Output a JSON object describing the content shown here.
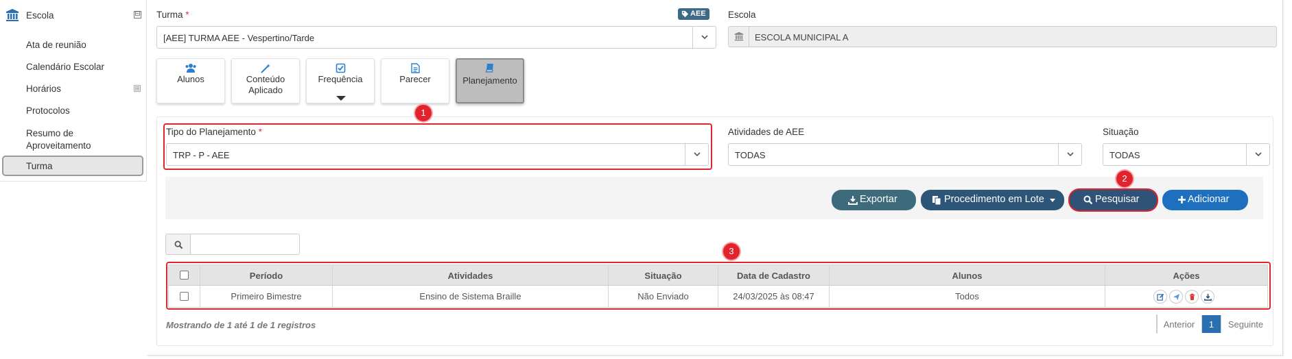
{
  "sidebar": {
    "title": "Escola",
    "items": [
      {
        "label": "Ata de reunião"
      },
      {
        "label": "Calendário Escolar"
      },
      {
        "label": "Horários"
      },
      {
        "label": "Protocolos"
      },
      {
        "label": "Resumo de Aproveitamento"
      },
      {
        "label": "Turma"
      }
    ],
    "active": "Turma",
    "expand_marker": "⊞",
    "collapse_marker": "⊟"
  },
  "turma": {
    "label": "Turma",
    "required_mark": "*",
    "value": "[AEE]  TURMA AEE - Vespertino/Tarde",
    "badge": "AEE"
  },
  "escola": {
    "label": "Escola",
    "value": "ESCOLA MUNICIPAL A"
  },
  "tiles": [
    {
      "label": "Alunos",
      "icon": "users-icon"
    },
    {
      "label": "Conteúdo Aplicado",
      "icon": "magic-wand-icon"
    },
    {
      "label": "Frequência",
      "icon": "check-square-icon"
    },
    {
      "label": "Parecer",
      "icon": "file-text-icon"
    },
    {
      "label": "Planejamento",
      "icon": "book-icon",
      "active": true
    }
  ],
  "filters": {
    "tipo": {
      "label": "Tipo do Planejamento",
      "required_mark": "*",
      "value": "TRP - P - AEE"
    },
    "atividades": {
      "label": "Atividades de AEE",
      "value": "TODAS"
    },
    "situacao": {
      "label": "Situação",
      "value": "TODAS"
    }
  },
  "actions": {
    "exportar": "Exportar",
    "lote": "Procedimento em Lote",
    "pesquisar": "Pesquisar",
    "adicionar": "Adicionar"
  },
  "search": {
    "placeholder": ""
  },
  "table": {
    "columns": [
      "Período",
      "Atividades",
      "Situação",
      "Data de Cadastro",
      "Alunos",
      "Ações"
    ],
    "rows": [
      {
        "periodo": "Primeiro Bimestre",
        "atividades": "Ensino de Sistema Braille",
        "situacao": "Não Enviado",
        "data": "24/03/2025 às 08:47",
        "alunos": "Todos"
      }
    ]
  },
  "footer": {
    "info": "Mostrando de 1 até 1 de 1 registros",
    "prev": "Anterior",
    "page": "1",
    "next": "Seguinte"
  },
  "annotations": [
    "1",
    "2",
    "3"
  ],
  "colors": {
    "accent": "#2a6fb0",
    "annotation_red": "#e0232d",
    "badge": "#3f6a85"
  }
}
